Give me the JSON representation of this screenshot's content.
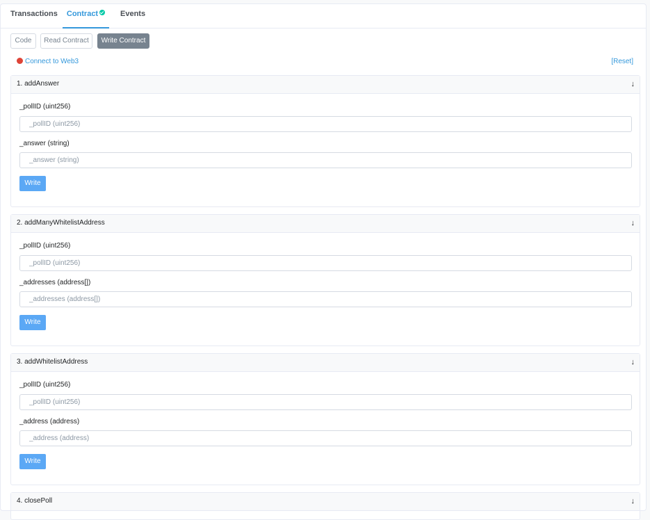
{
  "tabs": [
    {
      "label": "Transactions",
      "active": false
    },
    {
      "label": "Contract",
      "active": true,
      "badge": "check-circle-icon"
    },
    {
      "label": "Events",
      "active": false
    }
  ],
  "subtabs": [
    {
      "label": "Code",
      "active": false
    },
    {
      "label": "Read Contract",
      "active": false
    },
    {
      "label": "Write Contract",
      "active": true
    }
  ],
  "connect": {
    "label": "Connect to Web3",
    "status_color": "#de4437"
  },
  "reset_label": "[Reset]",
  "functions": [
    {
      "title": "1. addAnswer",
      "params": [
        {
          "label": "_pollID (uint256)",
          "placeholder": "_pollID (uint256)"
        },
        {
          "label": "_answer (string)",
          "placeholder": "_answer (string)"
        }
      ],
      "button": "Write"
    },
    {
      "title": "2. addManyWhitelistAddress",
      "params": [
        {
          "label": "_pollID (uint256)",
          "placeholder": "_pollID (uint256)"
        },
        {
          "label": "_addresses (address[])",
          "placeholder": "_addresses (address[])"
        }
      ],
      "button": "Write"
    },
    {
      "title": "3. addWhitelistAddress",
      "params": [
        {
          "label": "_pollID (uint256)",
          "placeholder": "_pollID (uint256)"
        },
        {
          "label": "_address (address)",
          "placeholder": "_address (address)"
        }
      ],
      "button": "Write"
    },
    {
      "title": "4. closePoll",
      "params": [],
      "button": ""
    }
  ],
  "colors": {
    "accent": "#3498db",
    "write_button": "#5ba8f5",
    "active_subtab": "#77838f"
  }
}
